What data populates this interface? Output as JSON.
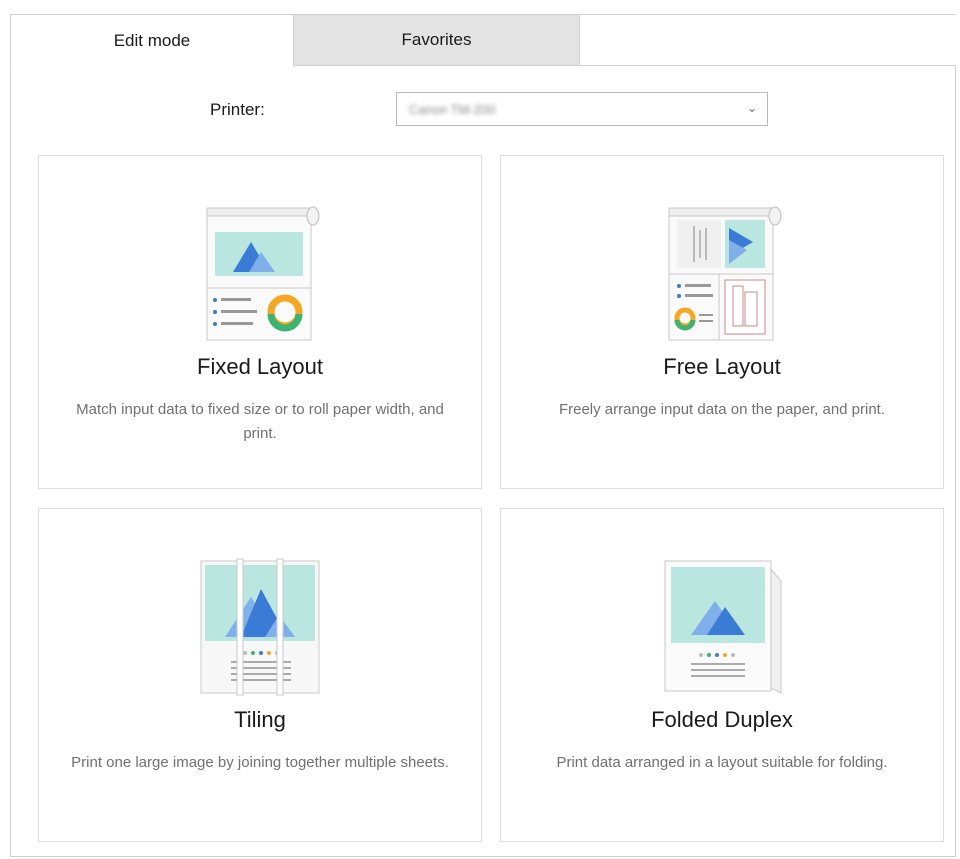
{
  "tabs": [
    {
      "label": "Edit mode",
      "active": true
    },
    {
      "label": "Favorites",
      "active": false
    }
  ],
  "printer": {
    "label": "Printer:",
    "value": "Canon TM-200"
  },
  "cards": [
    {
      "title": "Fixed Layout",
      "description": "Match input data to fixed size or to roll paper width, and print."
    },
    {
      "title": "Free Layout",
      "description": "Freely arrange input data on the paper, and print."
    },
    {
      "title": "Tiling",
      "description": "Print one large image by joining together multiple sheets."
    },
    {
      "title": "Folded Duplex",
      "description": "Print data arranged in a layout suitable for folding."
    }
  ],
  "icons": {
    "dropdown": "chevron-down-icon",
    "fixed_layout": "fixed-layout-icon",
    "free_layout": "free-layout-icon",
    "tiling": "tiling-icon",
    "folded_duplex": "folded-duplex-icon"
  },
  "colors": {
    "image_bg": "#b9e6df",
    "mountain_dark": "#3a7bd5",
    "mountain_light": "#7fb0ea",
    "donut_orange": "#f5a623",
    "donut_green": "#3cb371",
    "tab_inactive": "#e3e3e3"
  }
}
